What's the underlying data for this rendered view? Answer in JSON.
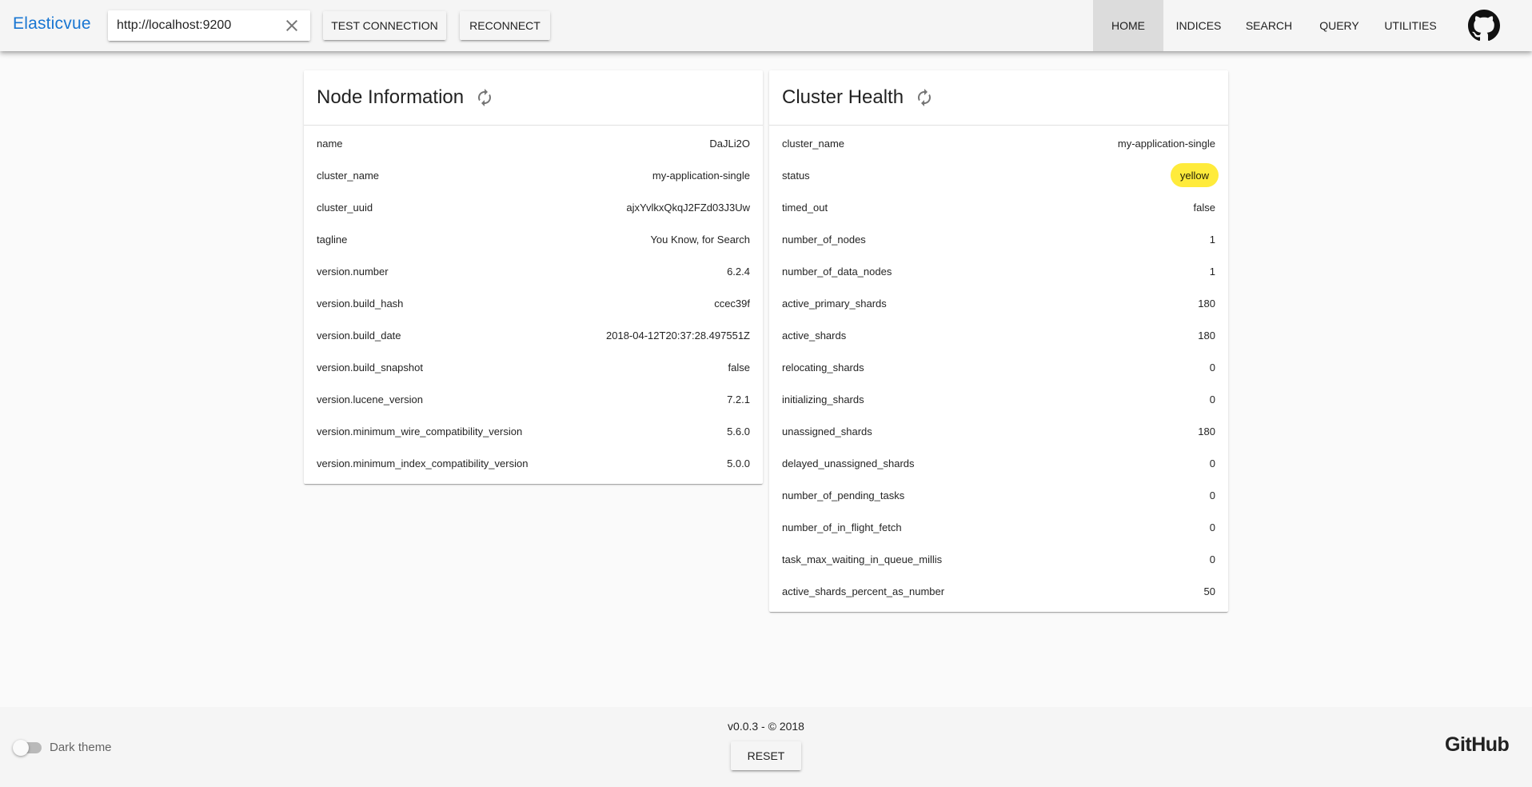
{
  "header": {
    "brand": "Elasticvue",
    "url_value": "http://localhost:9200",
    "test_connection_label": "Test connection",
    "reconnect_label": "Reconnect",
    "nav": [
      {
        "label": "Home",
        "active": true
      },
      {
        "label": "Indices",
        "active": false
      },
      {
        "label": "Search",
        "active": false
      },
      {
        "label": "Query",
        "active": false
      },
      {
        "label": "Utilities",
        "active": false
      }
    ]
  },
  "node_info": {
    "title": "Node Information",
    "rows": [
      {
        "key": "name",
        "value": "DaJLi2O"
      },
      {
        "key": "cluster_name",
        "value": "my-application-single"
      },
      {
        "key": "cluster_uuid",
        "value": "ajxYvlkxQkqJ2FZd03J3Uw"
      },
      {
        "key": "tagline",
        "value": "You Know, for Search"
      },
      {
        "key": "version.number",
        "value": "6.2.4"
      },
      {
        "key": "version.build_hash",
        "value": "ccec39f"
      },
      {
        "key": "version.build_date",
        "value": "2018-04-12T20:37:28.497551Z"
      },
      {
        "key": "version.build_snapshot",
        "value": "false"
      },
      {
        "key": "version.lucene_version",
        "value": "7.2.1"
      },
      {
        "key": "version.minimum_wire_compatibility_version",
        "value": "5.6.0"
      },
      {
        "key": "version.minimum_index_compatibility_version",
        "value": "5.0.0"
      }
    ]
  },
  "cluster_health": {
    "title": "Cluster Health",
    "status_color": "#ffeb3b",
    "rows": [
      {
        "key": "cluster_name",
        "value": "my-application-single"
      },
      {
        "key": "status",
        "value": "yellow"
      },
      {
        "key": "timed_out",
        "value": "false"
      },
      {
        "key": "number_of_nodes",
        "value": "1"
      },
      {
        "key": "number_of_data_nodes",
        "value": "1"
      },
      {
        "key": "active_primary_shards",
        "value": "180"
      },
      {
        "key": "active_shards",
        "value": "180"
      },
      {
        "key": "relocating_shards",
        "value": "0"
      },
      {
        "key": "initializing_shards",
        "value": "0"
      },
      {
        "key": "unassigned_shards",
        "value": "180"
      },
      {
        "key": "delayed_unassigned_shards",
        "value": "0"
      },
      {
        "key": "number_of_pending_tasks",
        "value": "0"
      },
      {
        "key": "number_of_in_flight_fetch",
        "value": "0"
      },
      {
        "key": "task_max_waiting_in_queue_millis",
        "value": "0"
      },
      {
        "key": "active_shards_percent_as_number",
        "value": "50"
      }
    ]
  },
  "footer": {
    "dark_theme_label": "Dark theme",
    "dark_theme_enabled": false,
    "version_text": "v0.0.3 - © 2018",
    "reset_label": "Reset",
    "github_label": "GitHub"
  },
  "icons": {
    "clear": "close-icon",
    "refresh": "refresh-icon",
    "github": "github-icon"
  },
  "colors": {
    "brand": "#1976d2",
    "toolbar": "#f5f5f5",
    "active_nav": "#dcdcdc",
    "status_yellow": "#ffeb3b"
  }
}
